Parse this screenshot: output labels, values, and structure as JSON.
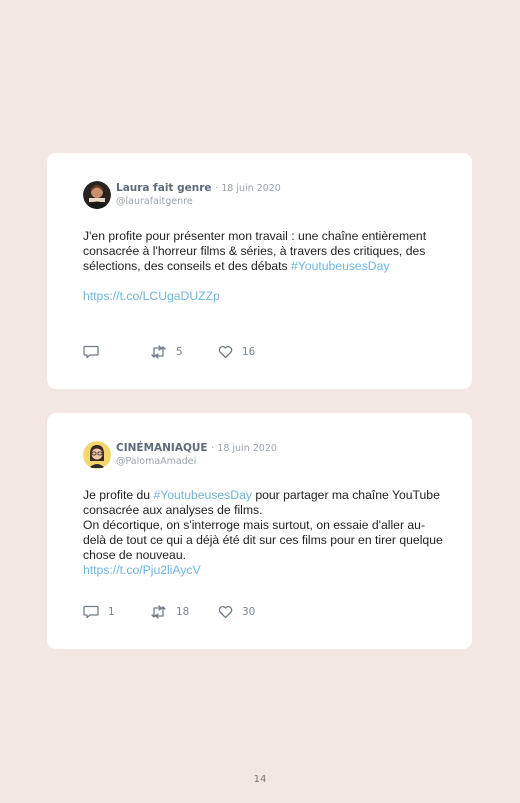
{
  "tweets": [
    {
      "author": "Laura fait genre",
      "date": "· 18 juin 2020",
      "handle": "@laurafaitgenre",
      "text_1": "J'en profite pour présenter mon travail : une chaîne entièrement consacrée à l'horreur films & séries, à travers des critiques, des sélections, des conseils et des débats ",
      "hashtag": "#YoutubeusesDay",
      "link": "https://t.co/LCUgaDUZZp",
      "replies": "",
      "retweets": "5",
      "likes": "16"
    },
    {
      "author": "CINÉMANIAQUE",
      "date": "· 18 juin 2020",
      "handle": "@PalomaAmadei",
      "text_1": "Je profite du ",
      "hashtag": "#YoutubeusesDay",
      "text_2": " pour partager ma chaîne YouTube consacrée aux analyses de films.",
      "text_3": "On décortique, on s'interroge mais surtout, on essaie d'aller au-delà de tout ce qui a déjà été dit sur ces films pour en tirer quelque chose de nouveau.",
      "link": "https://t.co/Pju2liAycV",
      "replies": "1",
      "retweets": "18",
      "likes": "30"
    }
  ],
  "page_number": "14",
  "colors": {
    "background": "#f3e7e4",
    "card": "#ffffff",
    "link": "#6fb6dc",
    "muted": "#9aa3ad"
  }
}
